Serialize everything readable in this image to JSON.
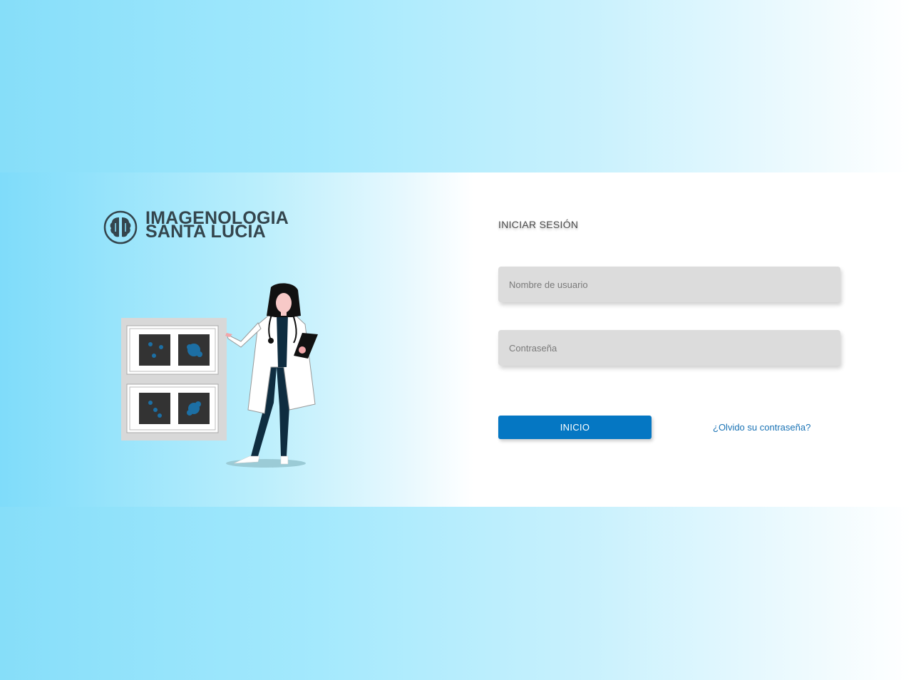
{
  "brand": {
    "line1": "IMAGENOLOGIA",
    "line2": "SANTA LUCIA",
    "icon": "brain-icon",
    "color": "#34454d"
  },
  "login": {
    "title": "INICIAR SESIÓN",
    "username_placeholder": "Nombre de usuario",
    "password_placeholder": "Contraseña",
    "submit_label": "INICIO",
    "forgot_label": "¿Olvido su contraseña?"
  },
  "colors": {
    "accent": "#0577c3",
    "link": "#1a73b5",
    "field_bg": "#dcdcdc",
    "background_light_blue": "#86def9"
  },
  "illustration": "doctor-with-xray-panel"
}
